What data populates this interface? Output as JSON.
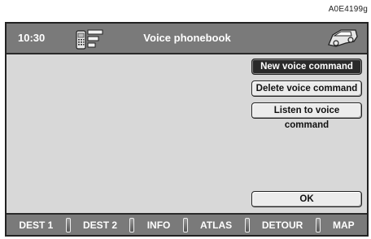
{
  "reference_code": "A0E4199g",
  "header": {
    "time": "10:30",
    "title": "Voice phonebook",
    "left_icon": "phone-menu-icon",
    "right_icon": "car-icon"
  },
  "menu": {
    "items": [
      {
        "label": "New voice command",
        "selected": true
      },
      {
        "label": "Delete voice command",
        "selected": false
      },
      {
        "label": "Listen to voice command",
        "selected": false
      }
    ],
    "ok_label": "OK"
  },
  "footer": {
    "tabs": [
      "DEST 1",
      "DEST 2",
      "INFO",
      "ATLAS",
      "DETOUR",
      "MAP"
    ]
  },
  "colors": {
    "bar": "#7a7a7a",
    "content": "#d8d8d8",
    "selected_button": "#2a2a2a",
    "button": "#ececec"
  }
}
